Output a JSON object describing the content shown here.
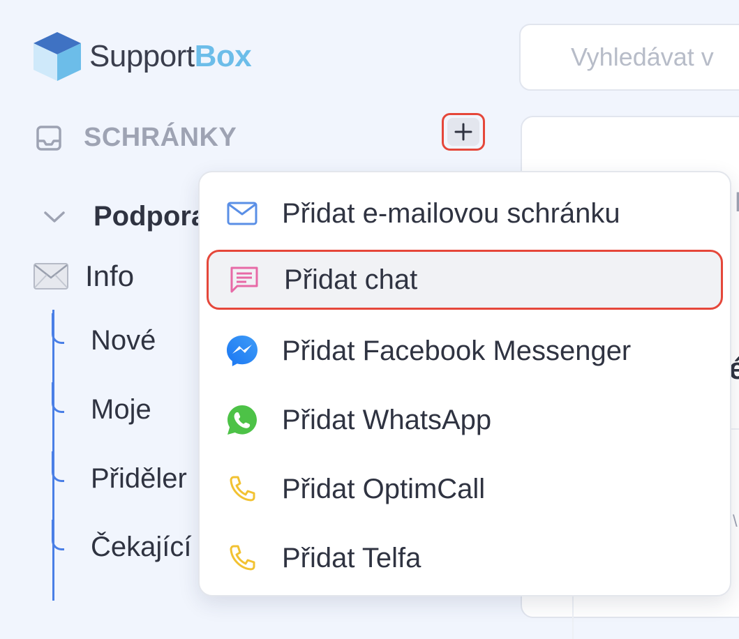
{
  "app": {
    "logo_text_main": "Support",
    "logo_text_accent": "Box",
    "colors": {
      "accent_blue": "#6cbde9",
      "tree_line": "#4a7fe6",
      "highlight_border": "#e5473a",
      "background": "#f1f5fd"
    }
  },
  "sidebar": {
    "section_title": "SCHRÁNKY",
    "section_icon": "inbox-tray-icon",
    "add_button_icon": "plus-icon",
    "group": {
      "label": "Podpora",
      "icon": "chevron-down-icon"
    },
    "mailbox": {
      "label": "Info",
      "icon": "envelope-icon"
    },
    "sub_items": [
      {
        "label": "Nové"
      },
      {
        "label": "Moje"
      },
      {
        "label": "Přiděler"
      },
      {
        "label": "Čekající"
      }
    ]
  },
  "search": {
    "placeholder": "Vyhledávat v",
    "icon": "search-icon"
  },
  "panel": {
    "fragment_1": "I",
    "fragment_2": "é",
    "fragment_3": "\\"
  },
  "dropdown": {
    "items": [
      {
        "label": "Přidat e-mailovou schránku",
        "icon": "envelope-icon",
        "highlighted": false
      },
      {
        "label": "Přidat chat",
        "icon": "chat-bubble-icon",
        "highlighted": true
      },
      {
        "label": "Přidat Facebook Messenger",
        "icon": "messenger-icon",
        "highlighted": false
      },
      {
        "label": "Přidat WhatsApp",
        "icon": "whatsapp-icon",
        "highlighted": false
      },
      {
        "label": "Přidat OptimCall",
        "icon": "phone-icon",
        "highlighted": false
      },
      {
        "label": "Přidat Telfa",
        "icon": "phone-icon",
        "highlighted": false
      }
    ]
  }
}
